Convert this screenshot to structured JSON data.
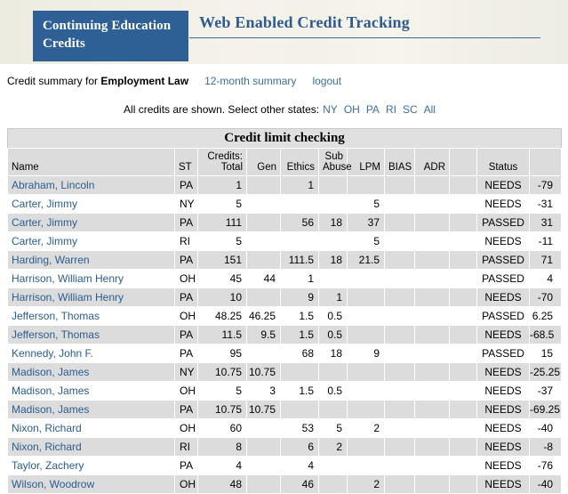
{
  "banner": {
    "box_line1": "Continuing Education",
    "box_line2": "Credits",
    "title": "Web Enabled Credit Tracking"
  },
  "subnav": {
    "prefix": "Credit summary for",
    "subject": "Employment Law",
    "summary_link": "12-month summary",
    "logout_link": "logout"
  },
  "states_bar": {
    "text": "All credits are shown. Select other states:",
    "links": [
      "NY",
      "OH",
      "PA",
      "RI",
      "SC",
      "All"
    ]
  },
  "table": {
    "caption": "Credit limit checking",
    "columns": [
      "Name",
      "ST",
      "Credits: Total",
      "Gen",
      "Ethics",
      "Sub Abuse",
      "LPM",
      "BIAS",
      "ADR",
      "",
      "Status",
      ""
    ],
    "column_header_lines": {
      "credits_total_l1": "Credits:",
      "credits_total_l2": "Total",
      "sub_abuse_l1": "Sub",
      "sub_abuse_l2": "Abuse"
    },
    "rows": [
      {
        "name": "Abraham, Lincoln",
        "st": "PA",
        "total": "1",
        "gen": "",
        "ethics": "1",
        "sub": "",
        "lpm": "",
        "bias": "",
        "adr": "",
        "extra": "",
        "status": "NEEDS",
        "delta": "-79"
      },
      {
        "name": "Carter, Jimmy",
        "st": "NY",
        "total": "5",
        "gen": "",
        "ethics": "",
        "sub": "",
        "lpm": "5",
        "bias": "",
        "adr": "",
        "extra": "",
        "status": "NEEDS",
        "delta": "-31"
      },
      {
        "name": "Carter, Jimmy",
        "st": "PA",
        "total": "111",
        "gen": "",
        "ethics": "56",
        "sub": "18",
        "lpm": "37",
        "bias": "",
        "adr": "",
        "extra": "",
        "status": "PASSED",
        "delta": "31"
      },
      {
        "name": "Carter, Jimmy",
        "st": "RI",
        "total": "5",
        "gen": "",
        "ethics": "",
        "sub": "",
        "lpm": "5",
        "bias": "",
        "adr": "",
        "extra": "",
        "status": "NEEDS",
        "delta": "-11"
      },
      {
        "name": "Harding, Warren",
        "st": "PA",
        "total": "151",
        "gen": "",
        "ethics": "111.5",
        "sub": "18",
        "lpm": "21.5",
        "bias": "",
        "adr": "",
        "extra": "",
        "status": "PASSED",
        "delta": "71"
      },
      {
        "name": "Harrison, William Henry",
        "st": "OH",
        "total": "45",
        "gen": "44",
        "ethics": "1",
        "sub": "",
        "lpm": "",
        "bias": "",
        "adr": "",
        "extra": "",
        "status": "PASSED",
        "delta": "4"
      },
      {
        "name": "Harrison, William Henry",
        "st": "PA",
        "total": "10",
        "gen": "",
        "ethics": "9",
        "sub": "1",
        "lpm": "",
        "bias": "",
        "adr": "",
        "extra": "",
        "status": "NEEDS",
        "delta": "-70"
      },
      {
        "name": "Jefferson, Thomas",
        "st": "OH",
        "total": "48.25",
        "gen": "46.25",
        "ethics": "1.5",
        "sub": "0.5",
        "lpm": "",
        "bias": "",
        "adr": "",
        "extra": "",
        "status": "PASSED",
        "delta": "6.25"
      },
      {
        "name": "Jefferson, Thomas",
        "st": "PA",
        "total": "11.5",
        "gen": "9.5",
        "ethics": "1.5",
        "sub": "0.5",
        "lpm": "",
        "bias": "",
        "adr": "",
        "extra": "",
        "status": "NEEDS",
        "delta": "-68.5"
      },
      {
        "name": "Kennedy, John F.",
        "st": "PA",
        "total": "95",
        "gen": "",
        "ethics": "68",
        "sub": "18",
        "lpm": "9",
        "bias": "",
        "adr": "",
        "extra": "",
        "status": "PASSED",
        "delta": "15"
      },
      {
        "name": "Madison, James",
        "st": "NY",
        "total": "10.75",
        "gen": "10.75",
        "ethics": "",
        "sub": "",
        "lpm": "",
        "bias": "",
        "adr": "",
        "extra": "",
        "status": "NEEDS",
        "delta": "-25.25"
      },
      {
        "name": "Madison, James",
        "st": "OH",
        "total": "5",
        "gen": "3",
        "ethics": "1.5",
        "sub": "0.5",
        "lpm": "",
        "bias": "",
        "adr": "",
        "extra": "",
        "status": "NEEDS",
        "delta": "-37"
      },
      {
        "name": "Madison, James",
        "st": "PA",
        "total": "10.75",
        "gen": "10.75",
        "ethics": "",
        "sub": "",
        "lpm": "",
        "bias": "",
        "adr": "",
        "extra": "",
        "status": "NEEDS",
        "delta": "-69.25"
      },
      {
        "name": "Nixon, Richard",
        "st": "OH",
        "total": "60",
        "gen": "",
        "ethics": "53",
        "sub": "5",
        "lpm": "2",
        "bias": "",
        "adr": "",
        "extra": "",
        "status": "NEEDS",
        "delta": "-40"
      },
      {
        "name": "Nixon, Richard",
        "st": "RI",
        "total": "8",
        "gen": "",
        "ethics": "6",
        "sub": "2",
        "lpm": "",
        "bias": "",
        "adr": "",
        "extra": "",
        "status": "NEEDS",
        "delta": "-8"
      },
      {
        "name": "Taylor, Zachery",
        "st": "PA",
        "total": "4",
        "gen": "",
        "ethics": "4",
        "sub": "",
        "lpm": "",
        "bias": "",
        "adr": "",
        "extra": "",
        "status": "NEEDS",
        "delta": "-76"
      },
      {
        "name": "Wilson, Woodrow",
        "st": "OH",
        "total": "48",
        "gen": "",
        "ethics": "46",
        "sub": "",
        "lpm": "2",
        "bias": "",
        "adr": "",
        "extra": "",
        "status": "NEEDS",
        "delta": "-40"
      }
    ]
  },
  "colors": {
    "banner_box": "#2e6096",
    "banner_title": "#2c5b92",
    "link": "#3a7196",
    "name_link": "#2a5d8f",
    "row_alt": "#dcdcdc",
    "caption_bg": "#e0e0e0"
  }
}
